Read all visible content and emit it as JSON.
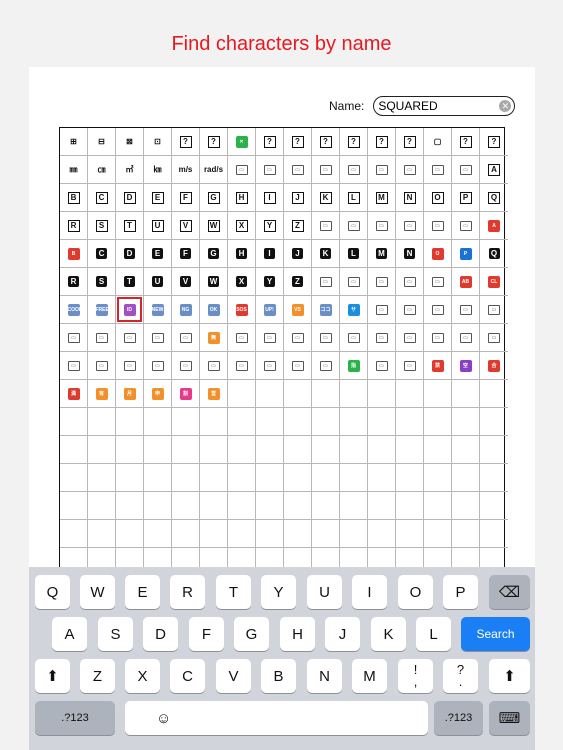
{
  "promo": {
    "title": "Find characters by name"
  },
  "search": {
    "label": "Name:",
    "value": "SQUARED",
    "clear_glyph": "✕"
  },
  "grid": {
    "rows": [
      [
        "⊞",
        "⊟",
        "⊠",
        "⊡",
        "?",
        "?",
        "✕",
        "?",
        "?",
        "?",
        "?",
        "?",
        "?",
        "▢",
        "?",
        "?"
      ],
      [
        "㎜",
        "㎝",
        "㎡",
        "㎞",
        "m/s",
        "rad/s",
        "▭",
        "▭",
        "▭",
        "▭",
        "▭",
        "▭",
        "▭",
        "▭",
        "▭",
        "A"
      ],
      [
        "B",
        "C",
        "D",
        "E",
        "F",
        "G",
        "H",
        "I",
        "J",
        "K",
        "L",
        "M",
        "N",
        "O",
        "P",
        "Q"
      ],
      [
        "R",
        "S",
        "T",
        "U",
        "V",
        "W",
        "X",
        "Y",
        "Z",
        "▭",
        "▭",
        "▭",
        "▭",
        "▭",
        "▭",
        "A"
      ],
      [
        "B",
        "C",
        "D",
        "E",
        "F",
        "G",
        "H",
        "I",
        "J",
        "K",
        "L",
        "M",
        "N",
        "O",
        "P",
        "Q"
      ],
      [
        "R",
        "S",
        "T",
        "U",
        "V",
        "W",
        "X",
        "Y",
        "Z",
        "▭",
        "▭",
        "▭",
        "▭",
        "▭",
        "AB",
        "CL"
      ],
      [
        "COOL",
        "FREE",
        "ID",
        "NEW",
        "NG",
        "OK",
        "SOS",
        "UP!",
        "VS",
        "ココ",
        "サ",
        "▭",
        "▭",
        "▭",
        "▭",
        "▭"
      ],
      [
        "▭",
        "▭",
        "▭",
        "▭",
        "▭",
        "無",
        "▭",
        "▭",
        "▭",
        "▭",
        "▭",
        "▭",
        "▭",
        "▭",
        "▭",
        "▭"
      ],
      [
        "▭",
        "▭",
        "▭",
        "▭",
        "▭",
        "▭",
        "▭",
        "▭",
        "▭",
        "▭",
        "指",
        "▭",
        "▭",
        "禁",
        "空",
        "合"
      ],
      [
        "満",
        "有",
        "月",
        "申",
        "割",
        "営",
        "",
        "",
        "",
        "",
        "",
        "",
        "",
        "",
        "",
        ""
      ],
      [
        "",
        "",
        "",
        "",
        "",
        "",
        "",
        "",
        "",
        "",
        "",
        "",
        "",
        "",
        "",
        ""
      ],
      [
        "",
        "",
        "",
        "",
        "",
        "",
        "",
        "",
        "",
        "",
        "",
        "",
        "",
        "",
        "",
        ""
      ],
      [
        "",
        "",
        "",
        "",
        "",
        "",
        "",
        "",
        "",
        "",
        "",
        "",
        "",
        "",
        "",
        ""
      ],
      [
        "",
        "",
        "",
        "",
        "",
        "",
        "",
        "",
        "",
        "",
        "",
        "",
        "",
        "",
        "",
        ""
      ],
      [
        "",
        "",
        "",
        "",
        "",
        "",
        "",
        "",
        "",
        "",
        "",
        "",
        "",
        "",
        "",
        ""
      ],
      [
        "",
        "",
        "",
        "",
        "",
        "",
        "",
        "",
        "",
        "",
        "",
        "",
        "",
        "",
        "",
        ""
      ]
    ],
    "styles": [
      [
        "t",
        "t",
        "t",
        "t",
        "b",
        "b",
        "e:#2bb34a",
        "b",
        "b",
        "b",
        "b",
        "b",
        "b",
        "t",
        "b",
        "b"
      ],
      [
        "t",
        "t",
        "t",
        "t",
        "t",
        "t",
        "m",
        "m",
        "m",
        "m",
        "m",
        "m",
        "m",
        "m",
        "m",
        "b"
      ],
      [
        "b",
        "b",
        "b",
        "b",
        "b",
        "b",
        "b",
        "b",
        "b",
        "b",
        "b",
        "b",
        "b",
        "b",
        "b",
        "b"
      ],
      [
        "b",
        "b",
        "b",
        "b",
        "b",
        "b",
        "b",
        "b",
        "b",
        "m",
        "m",
        "m",
        "m",
        "m",
        "m",
        "e:#e03a2e"
      ],
      [
        "e:#e03a2e",
        "k",
        "k",
        "k",
        "k",
        "k",
        "k",
        "k",
        "k",
        "k",
        "k",
        "k",
        "k",
        "e:#e03a2e",
        "e:#1c71d8",
        "k"
      ],
      [
        "k",
        "k",
        "k",
        "k",
        "k",
        "k",
        "k",
        "k",
        "k",
        "m",
        "m",
        "m",
        "m",
        "m",
        "e:#e03a2e",
        "e:#e03a2e"
      ],
      [
        "e:#6a8fc7",
        "e:#6a8fc7",
        "e:#a04fc4",
        "e:#6a8fc7",
        "e:#6a8fc7",
        "e:#6a8fc7",
        "e:#e03a2e",
        "e:#6a8fc7",
        "e:#f2902a",
        "e:#6a8fc7",
        "e:#1c8ee0",
        "m",
        "m",
        "m",
        "m",
        "m"
      ],
      [
        "m",
        "m",
        "m",
        "m",
        "m",
        "e:#f2902a",
        "m",
        "m",
        "m",
        "m",
        "m",
        "m",
        "m",
        "m",
        "m",
        "m"
      ],
      [
        "m",
        "m",
        "m",
        "m",
        "m",
        "m",
        "m",
        "m",
        "m",
        "m",
        "e:#2bb34a",
        "m",
        "m",
        "e:#e03a2e",
        "e:#8a3ec4",
        "e:#e03a2e"
      ],
      [
        "e:#e03a2e",
        "e:#f2902a",
        "e:#f2902a",
        "e:#f2902a",
        "e:#e83a8a",
        "e:#f2902a",
        "x",
        "x",
        "x",
        "x",
        "x",
        "x",
        "x",
        "x",
        "x",
        "x"
      ]
    ],
    "selected": {
      "row": 6,
      "col": 2
    }
  },
  "keyboard": {
    "row1": [
      "Q",
      "W",
      "E",
      "R",
      "T",
      "Y",
      "U",
      "I",
      "O",
      "P"
    ],
    "row2": [
      "A",
      "S",
      "D",
      "F",
      "G",
      "H",
      "J",
      "K",
      "L"
    ],
    "row3": [
      "Z",
      "X",
      "C",
      "V",
      "B",
      "N",
      "M"
    ],
    "backspace_glyph": "⌫",
    "search_label": "Search",
    "shift_glyph": "⬆",
    "punct1_top": "!",
    "punct1_bottom": ",",
    "punct2_top": "?",
    "punct2_bottom": ".",
    "numbers_label": ".?123",
    "emoji_glyph": "☺",
    "hide_keyboard_glyph": "⌨"
  }
}
